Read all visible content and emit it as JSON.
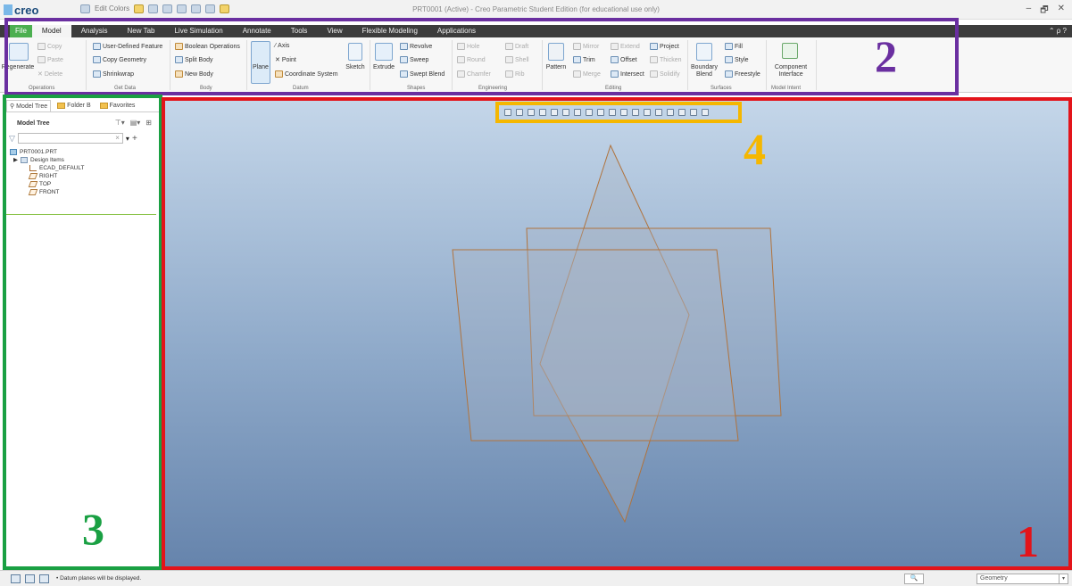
{
  "app": {
    "logo": "creo",
    "window_title": "PRT0001 (Active) - Creo Parametric Student Edition (for educational use only)",
    "window_controls": [
      "–",
      "🗗",
      "✕"
    ]
  },
  "quick_access": {
    "edit_colors": "Edit Colors"
  },
  "ribbon": {
    "tabs": [
      "File",
      "Model",
      "Analysis",
      "New Tab",
      "Live Simulation",
      "Annotate",
      "Tools",
      "View",
      "Flexible Modeling",
      "Applications"
    ],
    "active_tab": "Model",
    "help_icons": "⌃ ρ ?",
    "operations": {
      "regenerate": "Regenerate",
      "copy": "Copy",
      "paste": "Paste",
      "delete": "Delete",
      "group": "Operations"
    },
    "get_data": {
      "udf": "User-Defined Feature",
      "copy_geometry": "Copy Geometry",
      "shrinkwrap": "Shrinkwrap",
      "group": "Get Data"
    },
    "body": {
      "boolean": "Boolean Operations",
      "split": "Split Body",
      "new": "New Body",
      "group": "Body"
    },
    "datum": {
      "plane": "Plane",
      "axis": "Axis",
      "point": "Point",
      "csys": "Coordinate System",
      "sketch": "Sketch",
      "group": "Datum"
    },
    "shapes": {
      "extrude": "Extrude",
      "revolve": "Revolve",
      "sweep": "Sweep",
      "swept_blend": "Swept Blend",
      "group": "Shapes"
    },
    "engineering": {
      "hole": "Hole",
      "round": "Round",
      "chamfer": "Chamfer",
      "draft": "Draft",
      "shell": "Shell",
      "rib": "Rib",
      "group": "Engineering"
    },
    "editing": {
      "pattern": "Pattern",
      "mirror": "Mirror",
      "trim": "Trim",
      "merge": "Merge",
      "extend": "Extend",
      "offset": "Offset",
      "intersect": "Intersect",
      "project": "Project",
      "thicken": "Thicken",
      "solidify": "Solidify",
      "group": "Editing"
    },
    "surfaces": {
      "boundary_blend": "Boundary Blend",
      "fill": "Fill",
      "style": "Style",
      "freestyle": "Freestyle",
      "group": "Surfaces"
    },
    "model_intent": {
      "component_interface": "Component Interface",
      "group": "Model Intent"
    }
  },
  "model_tree": {
    "tabs": [
      "Model Tree",
      "Folder B",
      "Favorites"
    ],
    "title": "Model Tree",
    "search_placeholder": "",
    "items": [
      {
        "label": "PRT0001.PRT",
        "icon": "part-icon"
      },
      {
        "label": "Design Items",
        "icon": "design-items-icon"
      },
      {
        "label": "ECAD_DEFAULT",
        "icon": "csys-icon"
      },
      {
        "label": "RIGHT",
        "icon": "datum-plane-icon"
      },
      {
        "label": "TOP",
        "icon": "datum-plane-icon"
      },
      {
        "label": "FRONT",
        "icon": "datum-plane-icon"
      }
    ]
  },
  "annotations": {
    "n1": "1",
    "n2": "2",
    "n3": "3",
    "n4": "4",
    "colors": {
      "red": "#e3141a",
      "purple": "#6a2fa0",
      "green": "#1aa043",
      "yellow": "#f5b700"
    }
  },
  "status": {
    "message": "• Datum planes will be displayed.",
    "selection_filter": "Geometry",
    "find": "🔍"
  }
}
